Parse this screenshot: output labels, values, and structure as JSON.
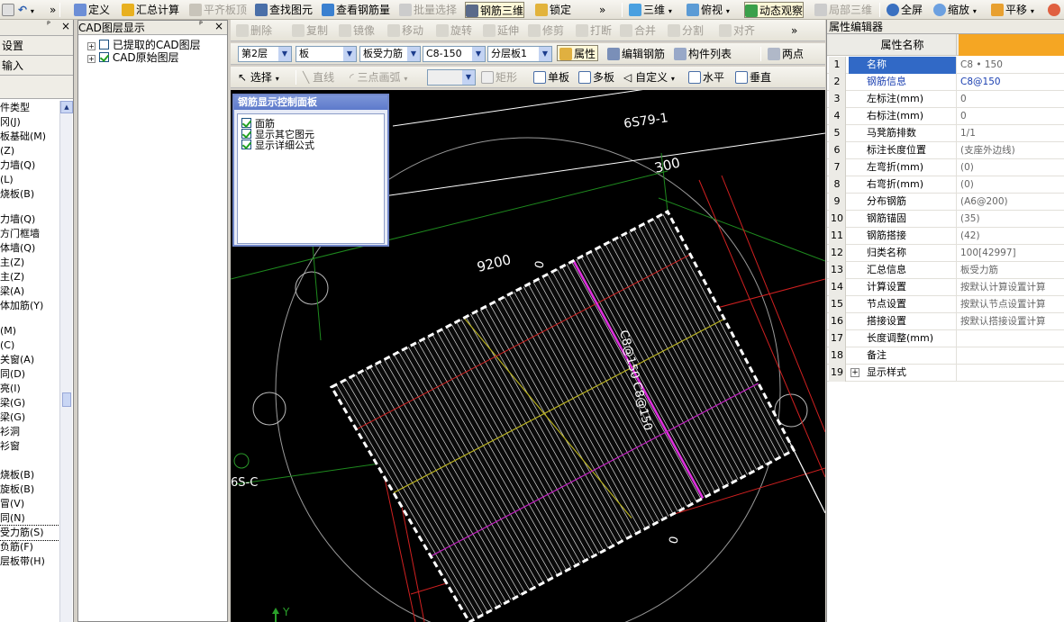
{
  "toolbar": {
    "items": [
      {
        "label": "定义",
        "icon": "define-icon"
      },
      {
        "label": "汇总计算",
        "icon": "sum-icon"
      },
      {
        "label": "平齐板顶",
        "icon": "level-icon",
        "disabled": true
      },
      {
        "label": "查找图元",
        "icon": "find-icon"
      },
      {
        "label": "查看钢筋量",
        "icon": "view-rebar-icon"
      },
      {
        "label": "批量选择",
        "icon": "batch-icon",
        "disabled": true
      },
      {
        "label": "钢筋三维",
        "icon": "rebar3d-icon"
      },
      {
        "label": "锁定",
        "icon": "lock-icon"
      },
      {
        "label": "三维",
        "icon": "cube-icon"
      },
      {
        "label": "俯视",
        "icon": "topview-icon"
      },
      {
        "label": "动态观察",
        "icon": "orbit-icon"
      },
      {
        "label": "局部三维",
        "icon": "local3d-icon",
        "disabled": true
      },
      {
        "label": "全屏",
        "icon": "fullscreen-icon"
      },
      {
        "label": "缩放",
        "icon": "zoom-icon"
      },
      {
        "label": "平移",
        "icon": "pan-icon"
      }
    ]
  },
  "left_panel": {
    "close_glyph": "×",
    "pin_glyph": "ᴾ",
    "btn_settings": "设置",
    "btn_input": "输入",
    "items_top": [
      "件类型",
      "冈(J)",
      "板基础(M)",
      "(Z)",
      "力墙(Q)",
      "(L)",
      "烧板(B)"
    ],
    "items_mid": [
      "力墙(Q)",
      "方门框墙",
      "体墙(Q)",
      "主(Z)",
      "主(Z)",
      "梁(A)",
      "体加筋(Y)"
    ],
    "items_low": [
      "(M)",
      "(C)",
      "关窗(A)",
      "同(D)",
      "亮(I)",
      "梁(G)",
      "梁(G)",
      "衫洞",
      "衫窗"
    ],
    "items_bottom": [
      "烧板(B)",
      "旋板(B)",
      "冒(V)",
      "同(N)",
      "受力筋(S)",
      "负筋(F)",
      "层板带(H)"
    ]
  },
  "cad_panel": {
    "title": "CAD图层显示",
    "layers": [
      {
        "label": "已提取的CAD图层",
        "checked": false
      },
      {
        "label": "CAD原始图层",
        "checked": true
      }
    ]
  },
  "edit_bar": [
    "删除",
    "复制",
    "镜像",
    "移动",
    "旋转",
    "延伸",
    "修剪",
    "打断",
    "合并",
    "分割",
    "对齐"
  ],
  "prop_bar": {
    "floor": "第2层",
    "type": "板",
    "subtype": "板受力筋",
    "spec": "C8-150",
    "layer": "分层板1",
    "btn_attr": "属性",
    "btn_edit": "编辑钢筋",
    "btn_list": "构件列表",
    "btn_twopoint": "两点"
  },
  "draw_bar": {
    "select": "选择",
    "line": "直线",
    "arc": "三点画弧",
    "rect": "矩形",
    "single": "单板",
    "multi": "多板",
    "custom": "自定义",
    "horizontal": "水平",
    "vertical": "垂直"
  },
  "float_panel": {
    "title": "钢筋显示控制面板",
    "options": [
      {
        "label": "面筋",
        "checked": true
      },
      {
        "label": "显示其它图元",
        "checked": true
      },
      {
        "label": "显示详细公式",
        "checked": true
      }
    ]
  },
  "canvas": {
    "labels": {
      "top": "6S79-1",
      "dim300": "300",
      "dim9200": "9200",
      "zero1": "0",
      "zero2": "0",
      "rebar": "C8@150 C8@150",
      "axis_c": "6S-C",
      "y_axis": "Y"
    }
  },
  "properties": {
    "title": "属性编辑器",
    "header": "属性名称",
    "rows": [
      {
        "num": "1",
        "name": "名称",
        "value": "C8 • 150",
        "selected": true
      },
      {
        "num": "2",
        "name": "钢筋信息",
        "value": "C8@150",
        "link": true
      },
      {
        "num": "3",
        "name": "左标注(mm)",
        "value": "0"
      },
      {
        "num": "4",
        "name": "右标注(mm)",
        "value": "0"
      },
      {
        "num": "5",
        "name": "马凳筋排数",
        "value": "1/1"
      },
      {
        "num": "6",
        "name": "标注长度位置",
        "value": "(支座外边线)"
      },
      {
        "num": "7",
        "name": "左弯折(mm)",
        "value": "(0)"
      },
      {
        "num": "8",
        "name": "右弯折(mm)",
        "value": "(0)"
      },
      {
        "num": "9",
        "name": "分布钢筋",
        "value": "(A6@200)"
      },
      {
        "num": "10",
        "name": "钢筋锚固",
        "value": "(35)"
      },
      {
        "num": "11",
        "name": "钢筋搭接",
        "value": "(42)"
      },
      {
        "num": "12",
        "name": "归类名称",
        "value": "100[42997]"
      },
      {
        "num": "13",
        "name": "汇总信息",
        "value": "板受力筋"
      },
      {
        "num": "14",
        "name": "计算设置",
        "value": "按默认计算设置计算"
      },
      {
        "num": "15",
        "name": "节点设置",
        "value": "按默认节点设置计算"
      },
      {
        "num": "16",
        "name": "搭接设置",
        "value": "按默认搭接设置计算"
      },
      {
        "num": "17",
        "name": "长度调整(mm)",
        "value": ""
      },
      {
        "num": "18",
        "name": "备注",
        "value": ""
      },
      {
        "num": "19",
        "name": "显示样式",
        "value": "",
        "expand": "+"
      }
    ]
  }
}
